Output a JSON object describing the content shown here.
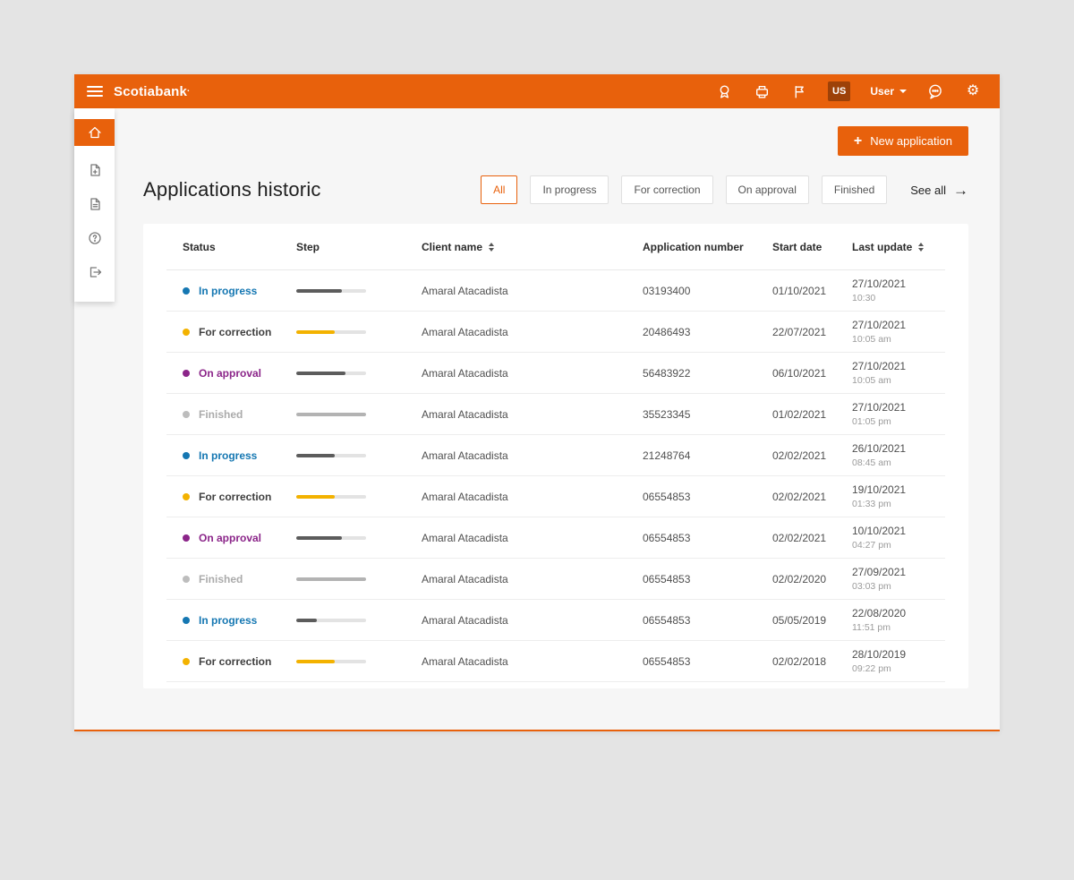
{
  "header": {
    "brand": "Scotiabank",
    "brand_suffix": ".",
    "country_badge": "US",
    "user_label": "User"
  },
  "icons": {
    "gear": "⚙",
    "see_all_arrow": "→",
    "new_application_plus": "+"
  },
  "sidebar": {
    "items": [
      {
        "icon": "home-icon",
        "active": true
      },
      {
        "icon": "new-document-icon",
        "active": false
      },
      {
        "icon": "documents-icon",
        "active": false
      },
      {
        "icon": "help-icon",
        "active": false
      },
      {
        "icon": "logout-icon",
        "active": false
      }
    ]
  },
  "page": {
    "new_application": "New application",
    "title": "Applications historic",
    "filters": [
      {
        "label": "All",
        "active": true
      },
      {
        "label": "In progress",
        "active": false
      },
      {
        "label": "For correction",
        "active": false
      },
      {
        "label": "On approval",
        "active": false
      },
      {
        "label": "Finished",
        "active": false
      }
    ],
    "see_all": "See all"
  },
  "colors": {
    "brand_orange": "#E8610C",
    "status": {
      "in-progress": {
        "text": "#1577B2",
        "dot": "#1577B2",
        "bar": "#5C5C5C"
      },
      "for-correction": {
        "text": "#3F3F3F",
        "dot": "#F3B200",
        "bar": "#F3B200"
      },
      "on-approval": {
        "text": "#8B2589",
        "dot": "#8B2589",
        "bar": "#5C5C5C"
      },
      "finished": {
        "text": "#ABABAB",
        "dot": "#BDBDBD",
        "bar": "#B3B3B3"
      }
    }
  },
  "table": {
    "columns": [
      "Status",
      "Step",
      "Client name",
      "Application number",
      "Start date",
      "Last update"
    ],
    "sortable_columns": [
      "Client name",
      "Last update"
    ],
    "rows": [
      {
        "status": "In progress",
        "key": "in-progress",
        "progress": 65,
        "client": "Amaral Atacadista",
        "application_number": "03193400",
        "start_date": "01/10/2021",
        "last_update_date": "27/10/2021",
        "last_update_time": "10:30"
      },
      {
        "status": "For correction",
        "key": "for-correction",
        "progress": 55,
        "client": "Amaral Atacadista",
        "application_number": "20486493",
        "start_date": "22/07/2021",
        "last_update_date": "27/10/2021",
        "last_update_time": "10:05 am"
      },
      {
        "status": "On approval",
        "key": "on-approval",
        "progress": 70,
        "client": "Amaral Atacadista",
        "application_number": "56483922",
        "start_date": "06/10/2021",
        "last_update_date": "27/10/2021",
        "last_update_time": "10:05 am"
      },
      {
        "status": "Finished",
        "key": "finished",
        "progress": 100,
        "client": "Amaral Atacadista",
        "application_number": "35523345",
        "start_date": "01/02/2021",
        "last_update_date": "27/10/2021",
        "last_update_time": "01:05 pm"
      },
      {
        "status": "In progress",
        "key": "in-progress",
        "progress": 55,
        "client": "Amaral Atacadista",
        "application_number": "21248764",
        "start_date": "02/02/2021",
        "last_update_date": "26/10/2021",
        "last_update_time": "08:45 am"
      },
      {
        "status": "For correction",
        "key": "for-correction",
        "progress": 55,
        "client": "Amaral Atacadista",
        "application_number": "06554853",
        "start_date": "02/02/2021",
        "last_update_date": "19/10/2021",
        "last_update_time": "01:33 pm"
      },
      {
        "status": "On approval",
        "key": "on-approval",
        "progress": 65,
        "client": "Amaral Atacadista",
        "application_number": "06554853",
        "start_date": "02/02/2021",
        "last_update_date": "10/10/2021",
        "last_update_time": "04:27 pm"
      },
      {
        "status": "Finished",
        "key": "finished",
        "progress": 100,
        "client": "Amaral Atacadista",
        "application_number": "06554853",
        "start_date": "02/02/2020",
        "last_update_date": "27/09/2021",
        "last_update_time": "03:03 pm"
      },
      {
        "status": "In progress",
        "key": "in-progress",
        "progress": 30,
        "client": "Amaral Atacadista",
        "application_number": "06554853",
        "start_date": "05/05/2019",
        "last_update_date": "22/08/2020",
        "last_update_time": "11:51 pm"
      },
      {
        "status": "For correction",
        "key": "for-correction",
        "progress": 55,
        "client": "Amaral Atacadista",
        "application_number": "06554853",
        "start_date": "02/02/2018",
        "last_update_date": "28/10/2019",
        "last_update_time": "09:22 pm"
      }
    ]
  }
}
